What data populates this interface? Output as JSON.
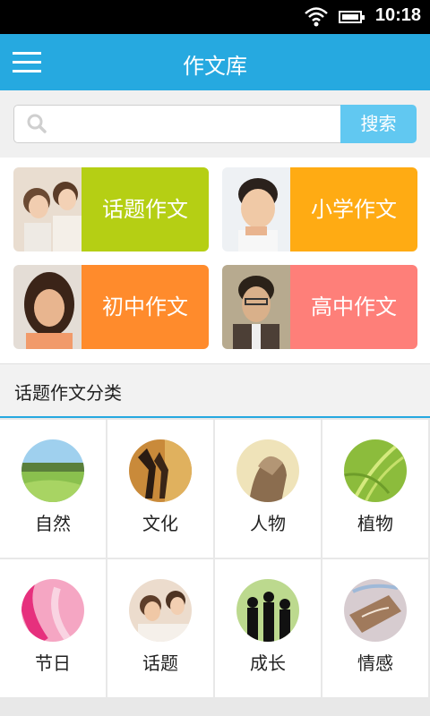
{
  "status_bar": {
    "time": "10:18",
    "wifi_icon": "wifi-icon",
    "battery_icon": "battery-icon"
  },
  "app_bar": {
    "title": "作文库",
    "menu_icon": "hamburger-menu-icon"
  },
  "search": {
    "placeholder": "",
    "value": "",
    "button_label": "搜索",
    "icon": "magnifier-icon"
  },
  "categories": [
    {
      "label": "话题作文",
      "color": "#b5cf14"
    },
    {
      "label": "小学作文",
      "color": "#ffab13"
    },
    {
      "label": "初中作文",
      "color": "#ff8b2c"
    },
    {
      "label": "高中作文",
      "color": "#fe7f79"
    }
  ],
  "section": {
    "title": "话题作文分类",
    "accent": "#26a9e0"
  },
  "topics": [
    {
      "label": "自然"
    },
    {
      "label": "文化"
    },
    {
      "label": "人物"
    },
    {
      "label": "植物"
    },
    {
      "label": "节日"
    },
    {
      "label": "话题"
    },
    {
      "label": "成长"
    },
    {
      "label": "情感"
    }
  ]
}
